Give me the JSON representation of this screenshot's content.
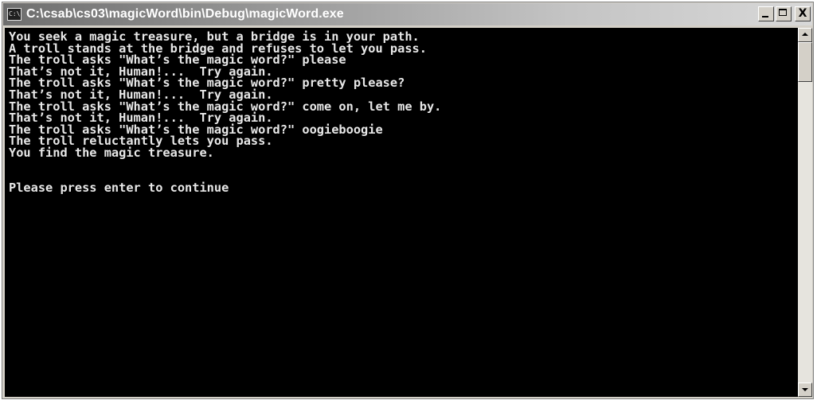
{
  "window": {
    "title": "C:\\csab\\cs03\\magicWord\\bin\\Debug\\magicWord.exe",
    "icon": "console-app-icon",
    "icon_text": "C:\\",
    "buttons": {
      "minimize": "minimize-icon",
      "maximize": "maximize-icon",
      "close": "close-icon",
      "close_glyph": "X"
    }
  },
  "console": {
    "background": "#000000",
    "foreground": "#e8e8e8",
    "lines": [
      "You seek a magic treasure, but a bridge is in your path.",
      "A troll stands at the bridge and refuses to let you pass.",
      "The troll asks \"What’s the magic word?\" please",
      "That’s not it, Human!...  Try again.",
      "The troll asks \"What’s the magic word?\" pretty please?",
      "That’s not it, Human!...  Try again.",
      "The troll asks \"What’s the magic word?\" come on, let me by.",
      "That’s not it, Human!...  Try again.",
      "The troll asks \"What’s the magic word?\" oogieboogie",
      "The troll reluctantly lets you pass.",
      "You find the magic treasure.",
      "",
      "",
      "Please press enter to continue"
    ]
  },
  "scrollbar": {
    "position": 0
  }
}
